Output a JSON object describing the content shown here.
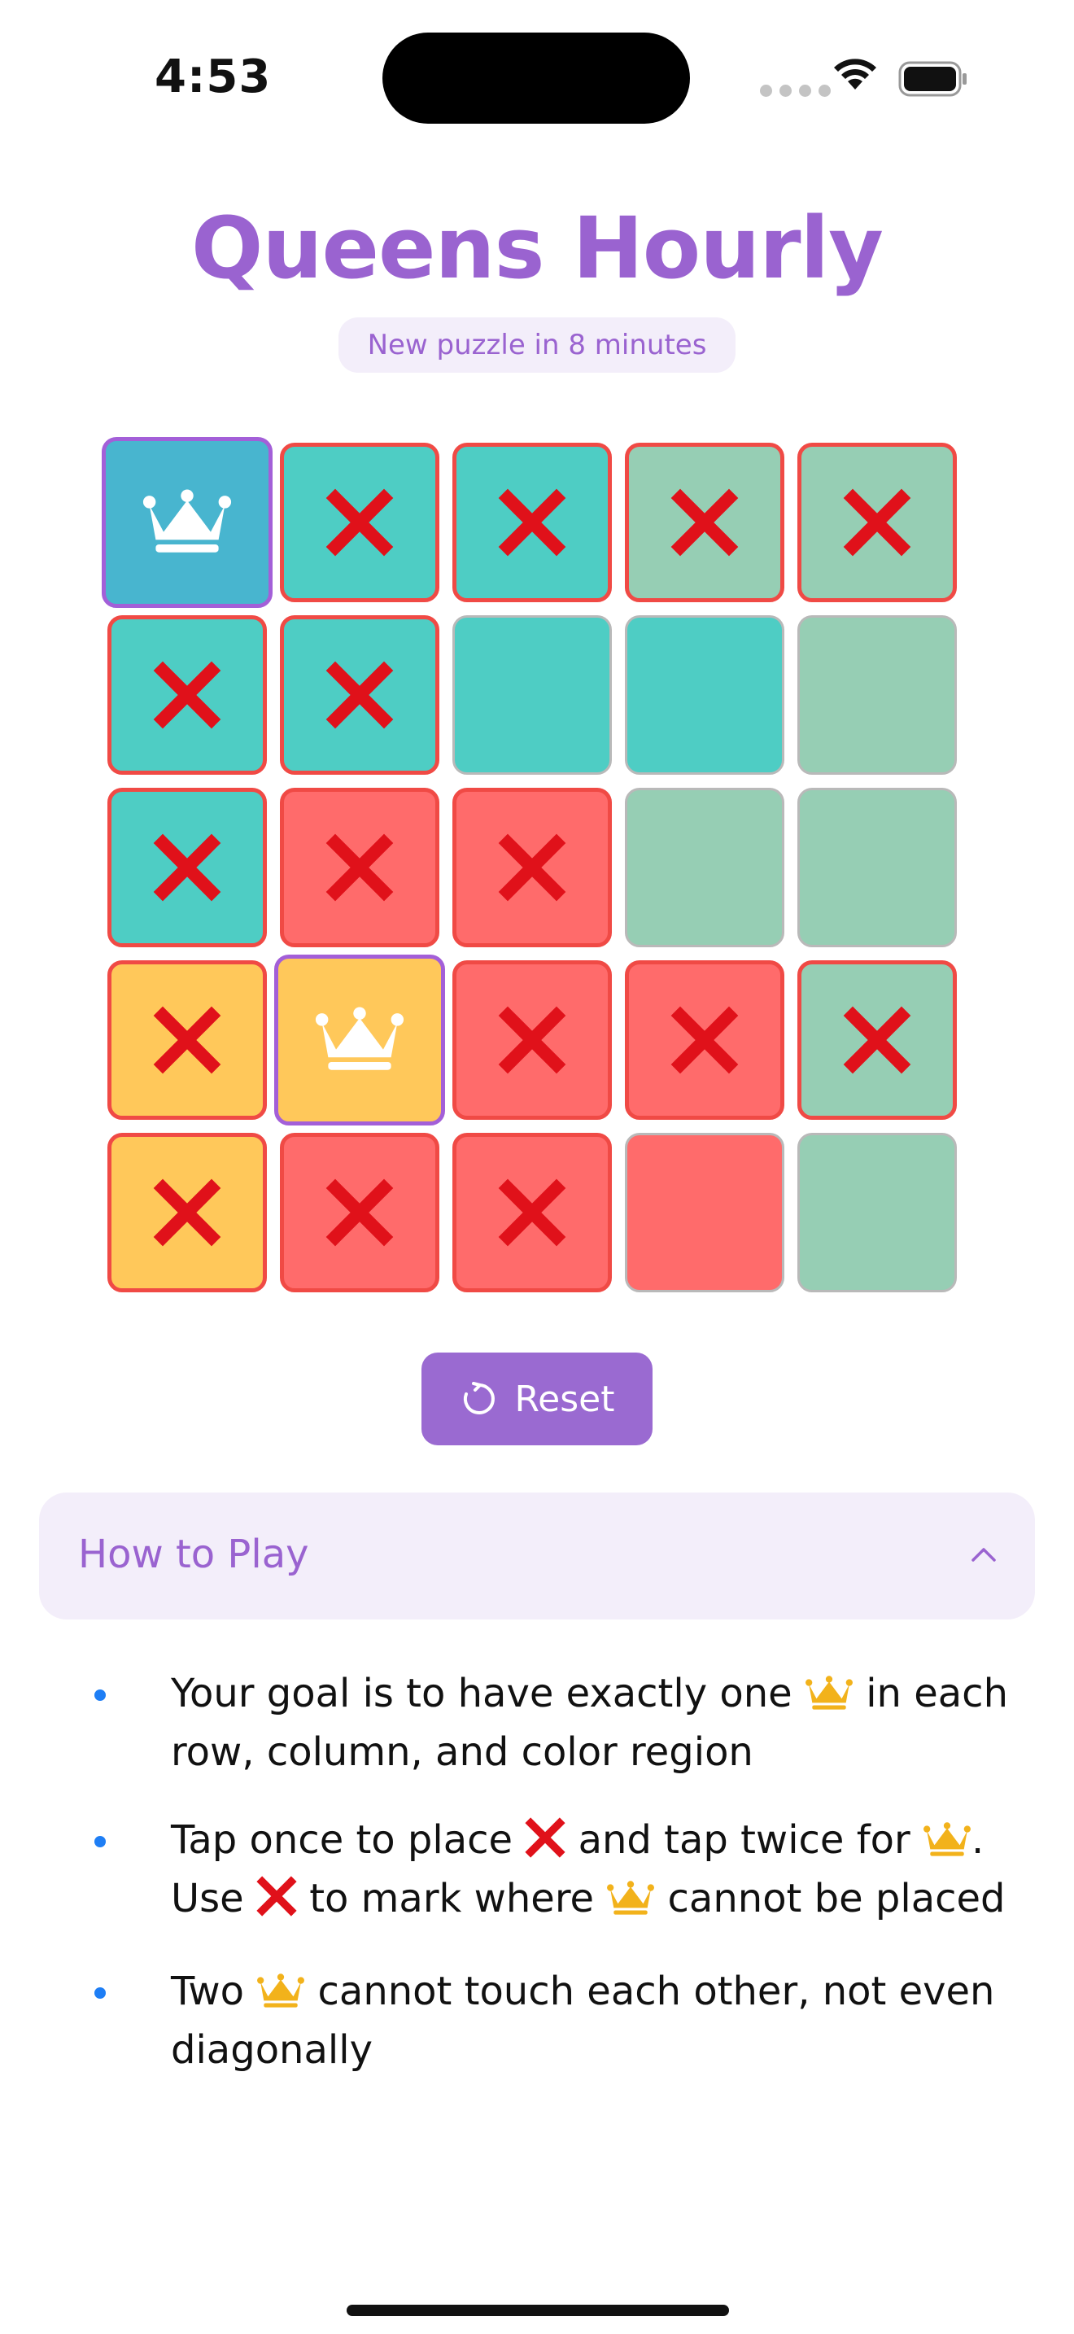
{
  "status": {
    "time": "4:53"
  },
  "app": {
    "title": "Queens Hourly",
    "subtitle": "New puzzle in 8 minutes"
  },
  "colors": {
    "accent": "#9a63d0",
    "blue": "#48b5cf",
    "teal": "#4ecdc4",
    "sage": "#96ceb4",
    "red": "#ff6b6b",
    "yellow": "#ffc85a",
    "conflict_border": "#f04a45"
  },
  "board": {
    "size": 5,
    "rows": [
      [
        {
          "region": "blue",
          "mark": "queen",
          "state": "queen"
        },
        {
          "region": "teal",
          "mark": "x",
          "state": "conflict"
        },
        {
          "region": "teal",
          "mark": "x",
          "state": "conflict"
        },
        {
          "region": "sage",
          "mark": "x",
          "state": "conflict"
        },
        {
          "region": "sage",
          "mark": "x",
          "state": "conflict"
        }
      ],
      [
        {
          "region": "teal",
          "mark": "x",
          "state": "conflict"
        },
        {
          "region": "teal",
          "mark": "x",
          "state": "conflict"
        },
        {
          "region": "teal",
          "mark": "",
          "state": "normal"
        },
        {
          "region": "teal",
          "mark": "",
          "state": "normal"
        },
        {
          "region": "sage",
          "mark": "",
          "state": "normal"
        }
      ],
      [
        {
          "region": "teal",
          "mark": "x",
          "state": "conflict"
        },
        {
          "region": "red",
          "mark": "x",
          "state": "conflict"
        },
        {
          "region": "red",
          "mark": "x",
          "state": "conflict"
        },
        {
          "region": "sage",
          "mark": "",
          "state": "normal"
        },
        {
          "region": "sage",
          "mark": "",
          "state": "normal"
        }
      ],
      [
        {
          "region": "yellow",
          "mark": "x",
          "state": "conflict"
        },
        {
          "region": "yellow",
          "mark": "queen",
          "state": "queen"
        },
        {
          "region": "red",
          "mark": "x",
          "state": "conflict"
        },
        {
          "region": "red",
          "mark": "x",
          "state": "conflict"
        },
        {
          "region": "sage",
          "mark": "x",
          "state": "conflict"
        }
      ],
      [
        {
          "region": "yellow",
          "mark": "x",
          "state": "conflict"
        },
        {
          "region": "red",
          "mark": "x",
          "state": "conflict"
        },
        {
          "region": "red",
          "mark": "x",
          "state": "conflict"
        },
        {
          "region": "red",
          "mark": "",
          "state": "normal"
        },
        {
          "region": "sage",
          "mark": "",
          "state": "normal"
        }
      ]
    ]
  },
  "reset": {
    "label": "Reset",
    "icon": "refresh-icon"
  },
  "how_to": {
    "title": "How to Play",
    "expanded": true,
    "rules": [
      [
        {
          "t": "text",
          "v": "Your goal is to have exactly one "
        },
        {
          "t": "emoji",
          "v": "crown"
        },
        {
          "t": "text",
          "v": " in each row, column, and color region"
        }
      ],
      [
        {
          "t": "text",
          "v": "Tap once to place "
        },
        {
          "t": "emoji",
          "v": "x"
        },
        {
          "t": "text",
          "v": " and tap twice for "
        },
        {
          "t": "emoji",
          "v": "crown"
        },
        {
          "t": "text",
          "v": ". Use "
        },
        {
          "t": "emoji",
          "v": "x"
        },
        {
          "t": "text",
          "v": " to mark where "
        },
        {
          "t": "emoji",
          "v": "crown"
        },
        {
          "t": "text",
          "v": " cannot be placed"
        }
      ],
      [
        {
          "t": "text",
          "v": "Two "
        },
        {
          "t": "emoji",
          "v": "crown"
        },
        {
          "t": "text",
          "v": " cannot touch each other, not even diagonally"
        }
      ]
    ]
  }
}
